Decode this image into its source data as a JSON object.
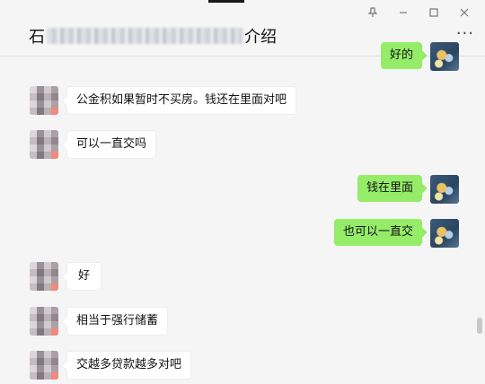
{
  "header": {
    "title_prefix": "石",
    "title_suffix": "介绍",
    "more_label": "···"
  },
  "window_controls": {
    "pin_icon": "pin-icon",
    "minimize_icon": "minimize-icon",
    "maximize_icon": "maximize-icon",
    "close_icon": "close-icon"
  },
  "messages": [
    {
      "side": "right",
      "text": "好的"
    },
    {
      "side": "left",
      "text": "公金积如果暂时不买房。钱还在里面对吧"
    },
    {
      "side": "left",
      "text": "可以一直交吗"
    },
    {
      "side": "right",
      "text": "钱在里面"
    },
    {
      "side": "right",
      "text": "也可以一直交"
    },
    {
      "side": "left",
      "text": "好"
    },
    {
      "side": "left",
      "text": "相当于强行储蓄"
    },
    {
      "side": "left",
      "text": "交越多贷款越多对吧"
    }
  ],
  "colors": {
    "background": "#f5f5f5",
    "bubble_right": "#95ec69",
    "bubble_left": "#ffffff"
  }
}
